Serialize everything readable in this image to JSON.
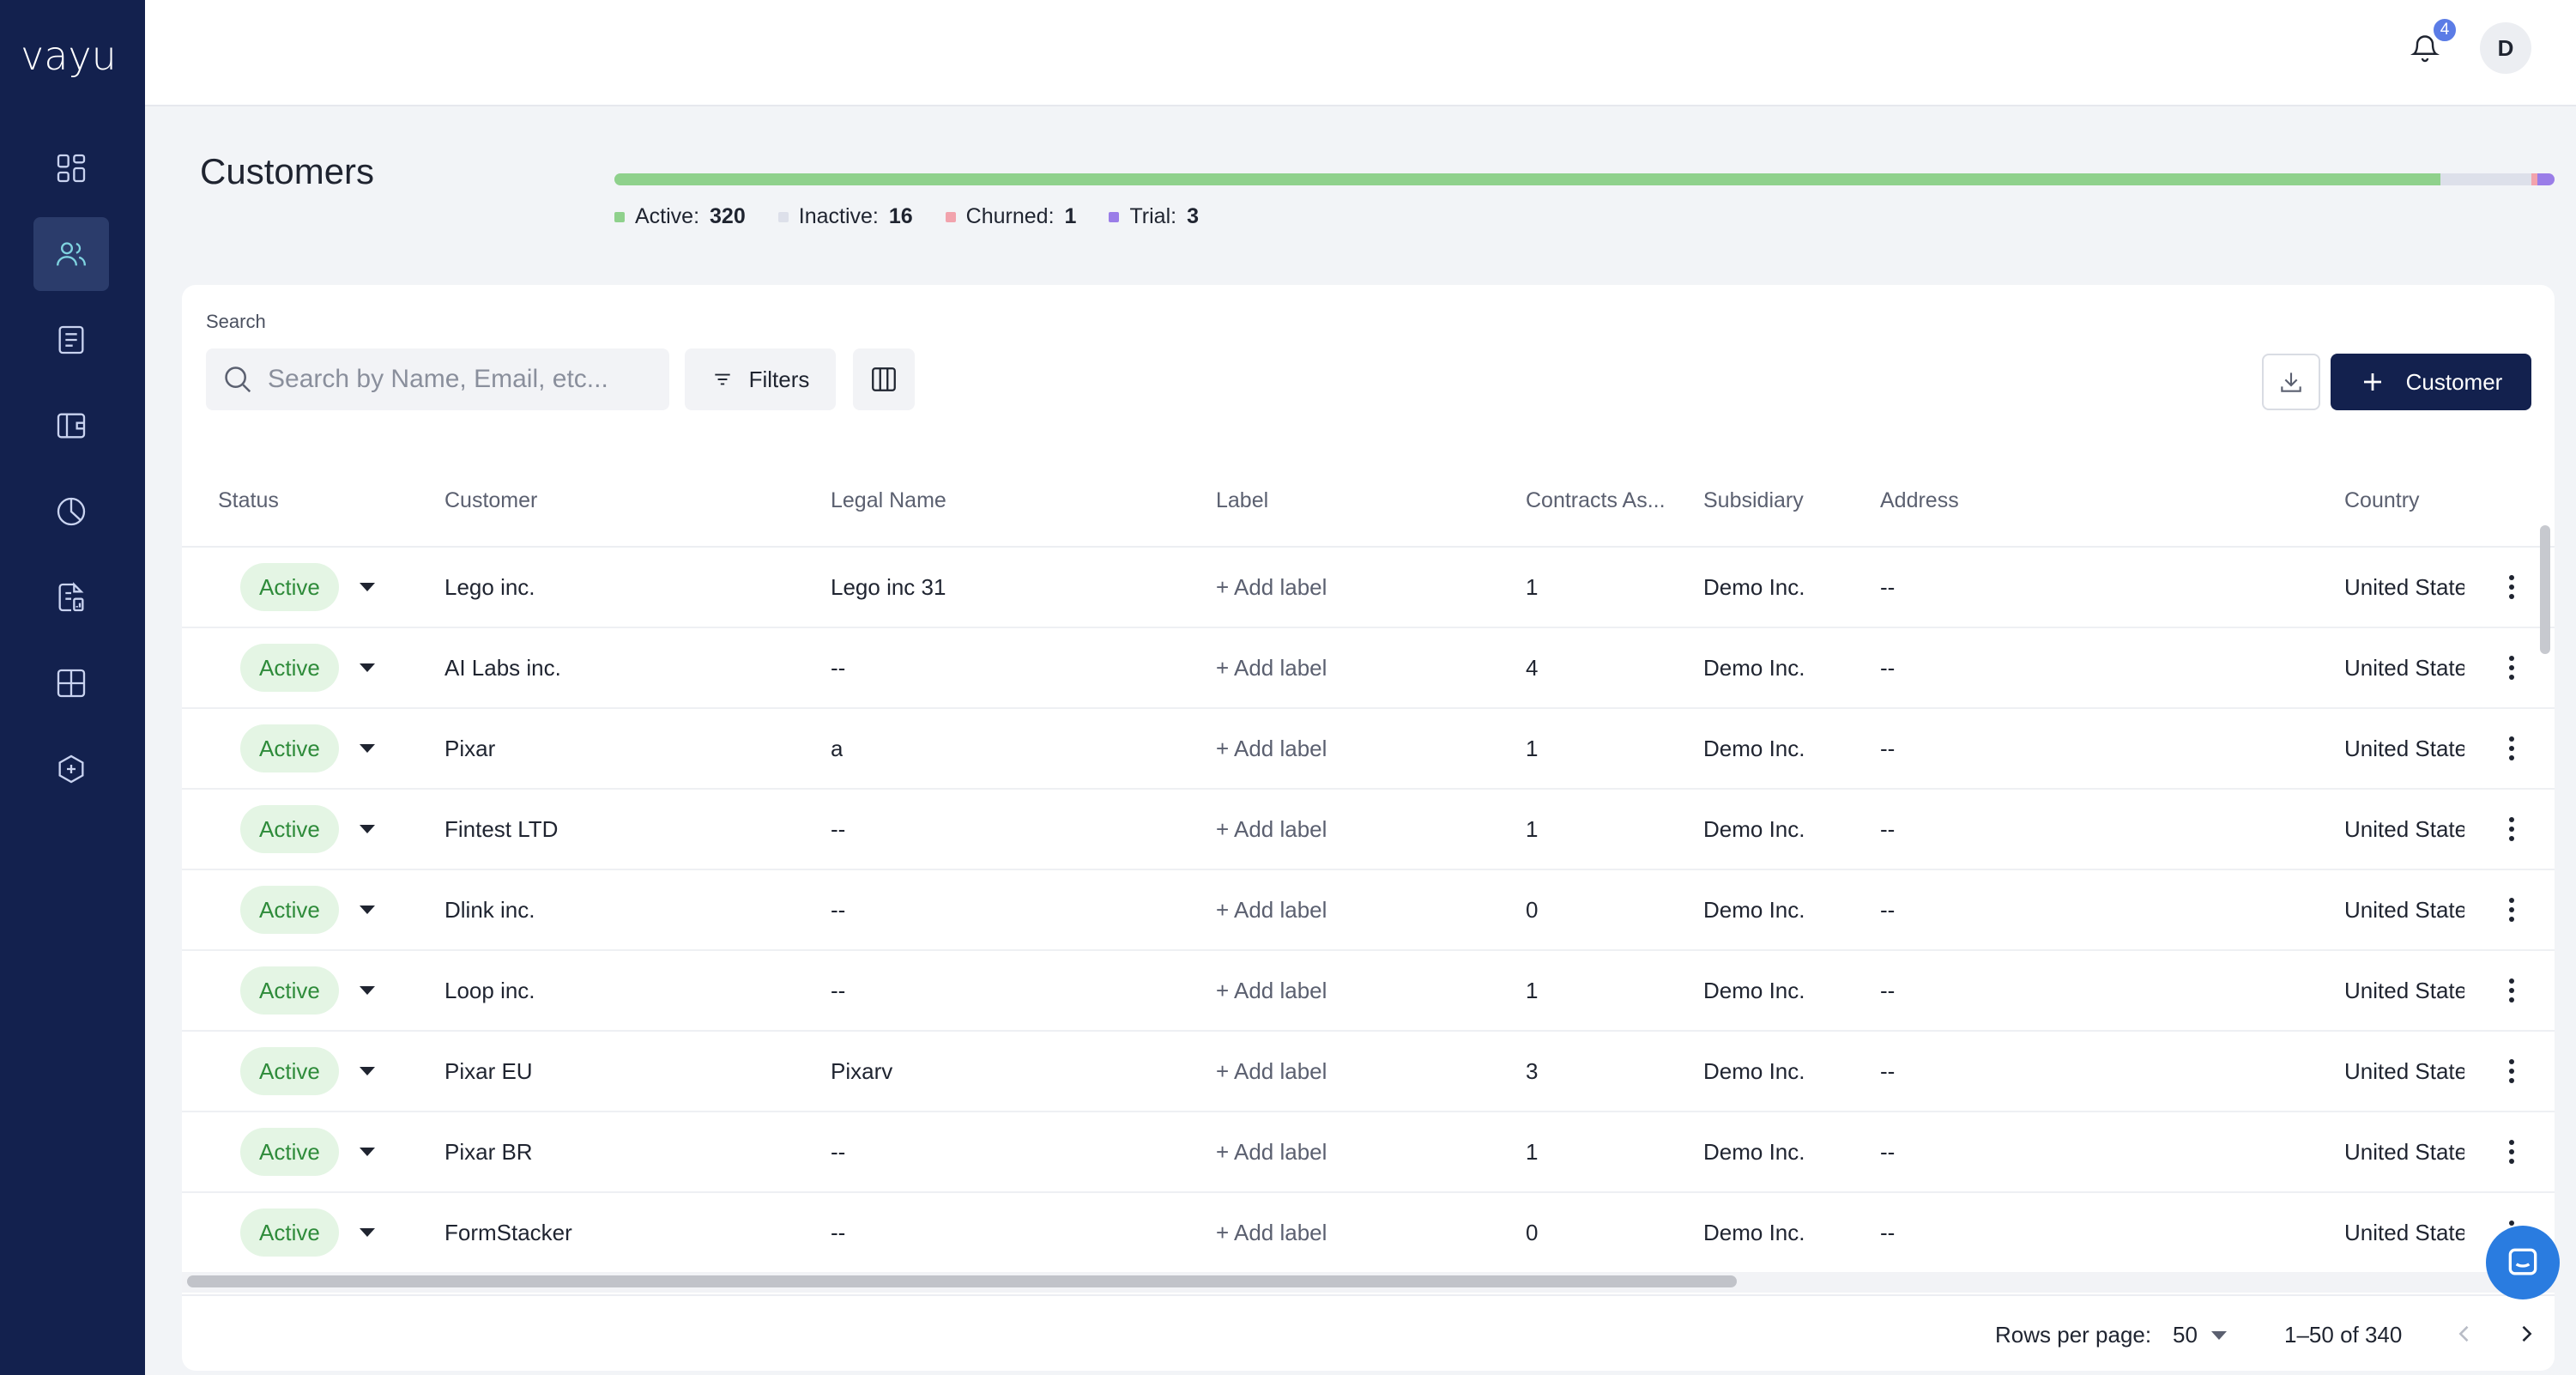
{
  "app": {
    "logo": "vayu"
  },
  "sidebar": {
    "items": [
      {
        "icon": "dashboard-icon",
        "active": false
      },
      {
        "icon": "users-icon",
        "active": true
      },
      {
        "icon": "invoice-icon",
        "active": false
      },
      {
        "icon": "wallet-icon",
        "active": false
      },
      {
        "icon": "pie-chart-icon",
        "active": false
      },
      {
        "icon": "reports-icon",
        "active": false
      },
      {
        "icon": "layout-icon",
        "active": false
      },
      {
        "icon": "integrations-icon",
        "active": false
      }
    ]
  },
  "topbar": {
    "notification_count": "4",
    "avatar_initial": "D"
  },
  "page": {
    "title": "Customers"
  },
  "status_summary": {
    "colors": {
      "active": "#8fd18c",
      "inactive": "#dde0ea",
      "churned": "#f2a3ad",
      "trial": "#9a7de8"
    },
    "items": [
      {
        "label": "Active:",
        "value": "320"
      },
      {
        "label": "Inactive:",
        "value": "16"
      },
      {
        "label": "Churned:",
        "value": "1"
      },
      {
        "label": "Trial:",
        "value": "3"
      }
    ]
  },
  "toolbar": {
    "search_label": "Search",
    "search_placeholder": "Search by Name, Email, etc...",
    "filters_label": "Filters",
    "add_customer_label": "Customer"
  },
  "table": {
    "columns": [
      "Status",
      "Customer",
      "Legal Name",
      "Label",
      "Contracts As...",
      "Subsidiary",
      "Address",
      "Country"
    ],
    "rows": [
      {
        "status": "Active",
        "customer": "Lego inc.",
        "legal_name": "Lego inc 31",
        "label": "+ Add label",
        "contracts": "1",
        "subsidiary": "Demo Inc.",
        "address": "--",
        "country": "United State"
      },
      {
        "status": "Active",
        "customer": "AI Labs inc.",
        "legal_name": "--",
        "label": "+ Add label",
        "contracts": "4",
        "subsidiary": "Demo Inc.",
        "address": "--",
        "country": "United State"
      },
      {
        "status": "Active",
        "customer": "Pixar",
        "legal_name": "a",
        "label": "+ Add label",
        "contracts": "1",
        "subsidiary": "Demo Inc.",
        "address": "--",
        "country": "United State"
      },
      {
        "status": "Active",
        "customer": "Fintest LTD",
        "legal_name": "--",
        "label": "+ Add label",
        "contracts": "1",
        "subsidiary": "Demo Inc.",
        "address": "--",
        "country": "United State"
      },
      {
        "status": "Active",
        "customer": "Dlink inc.",
        "legal_name": "--",
        "label": "+ Add label",
        "contracts": "0",
        "subsidiary": "Demo Inc.",
        "address": "--",
        "country": "United State"
      },
      {
        "status": "Active",
        "customer": "Loop inc.",
        "legal_name": "--",
        "label": "+ Add label",
        "contracts": "1",
        "subsidiary": "Demo Inc.",
        "address": "--",
        "country": "United State"
      },
      {
        "status": "Active",
        "customer": "Pixar EU",
        "legal_name": "Pixarv",
        "label": "+ Add label",
        "contracts": "3",
        "subsidiary": "Demo Inc.",
        "address": "--",
        "country": "United State"
      },
      {
        "status": "Active",
        "customer": "Pixar BR",
        "legal_name": "--",
        "label": "+ Add label",
        "contracts": "1",
        "subsidiary": "Demo Inc.",
        "address": "--",
        "country": "United State"
      },
      {
        "status": "Active",
        "customer": "FormStacker",
        "legal_name": "--",
        "label": "+ Add label",
        "contracts": "0",
        "subsidiary": "Demo Inc.",
        "address": "--",
        "country": "United State"
      }
    ]
  },
  "pagination": {
    "rows_per_page_label": "Rows per page:",
    "rows_per_page": "50",
    "range": "1–50 of 340"
  }
}
